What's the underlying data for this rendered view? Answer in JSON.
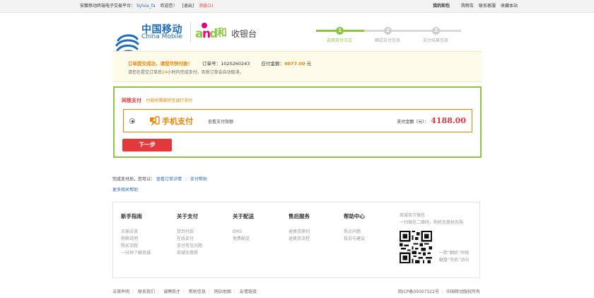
{
  "topbar": {
    "welcome_prefix": "安徽移动终端电子交易平台：",
    "username": "Sylvia_fa",
    "welcome": "欢迎您！",
    "logout": "[退出]",
    "messages": "消息(1)",
    "my_hebao": "我的和包",
    "cart": "购物车",
    "contact_service": "联系客服",
    "favorites": "收藏本站"
  },
  "header": {
    "logo_cn": "中国移动",
    "logo_en": "China Mobile",
    "andhe_he": "和",
    "cashier_title": "收银台",
    "steps": [
      {
        "num": "1",
        "label": "选择支付方式"
      },
      {
        "num": "2",
        "label": "確認支付信息"
      },
      {
        "num": "3",
        "label": "支付结果信息"
      }
    ]
  },
  "notice": {
    "success_msg": "订单提交成功，请您尽快付款！",
    "order_no_label": "订单号：",
    "order_no": "1020260243",
    "payable_label": "应付金额：",
    "payable_amount": "4077.00",
    "payable_unit": "元",
    "reminder_pre": "请您在提交订单后",
    "reminder_hours": "24",
    "reminder_post": "小时内完成支付，否则订单会自动取消。"
  },
  "payment": {
    "section_title": "网银支付",
    "section_hint": "付款时需跳转至银行支付",
    "method_name": "手机支付",
    "limit_link": "查看支付限额",
    "amount_label": "支付金额（元）：",
    "amount": "4188.00",
    "next_button": "下一步"
  },
  "after_payment": {
    "label": "完成支付后，您可以：",
    "view_order": "查看订单详情",
    "sep": "|",
    "pay_help": "支付帮助",
    "more_help": "更多相关帮助"
  },
  "footer": {
    "columns": [
      {
        "title": "新手指南",
        "items": [
          "买家必读",
          "购物说明",
          "购买流程",
          "一分钟了解商城"
        ]
      },
      {
        "title": "关于支付",
        "items": [
          "货到付款",
          "在线支付",
          "支付常见问题",
          "商城优惠券"
        ]
      },
      {
        "title": "关于配送",
        "items": [
          "EMS",
          "免费配送"
        ]
      },
      {
        "title": "售后服务",
        "items": [
          "退换货原则",
          "退换货流程"
        ]
      },
      {
        "title": "帮助中心",
        "items": [
          "热点问题",
          "投诉与建议"
        ]
      }
    ],
    "qr_title": "商城官方微信",
    "qr_sub": "一扫微信二维码，购机优惠抢先购",
    "qr_side": [
      "一箭“翻机”时抢",
      "翻盘“先机”动向"
    ],
    "links": [
      "法律声明",
      "联系我们",
      "诚聘英才",
      "帮助信息",
      "网站地图",
      "友情链接"
    ],
    "icp": "皖ICP备05007322号",
    "copyright": "中国移动版权所有"
  },
  "colors": {
    "brand_blue": "#1f6cb8",
    "accent_red": "#e4393c",
    "accent_orange": "#f08200",
    "step_green": "#8dc63f"
  }
}
